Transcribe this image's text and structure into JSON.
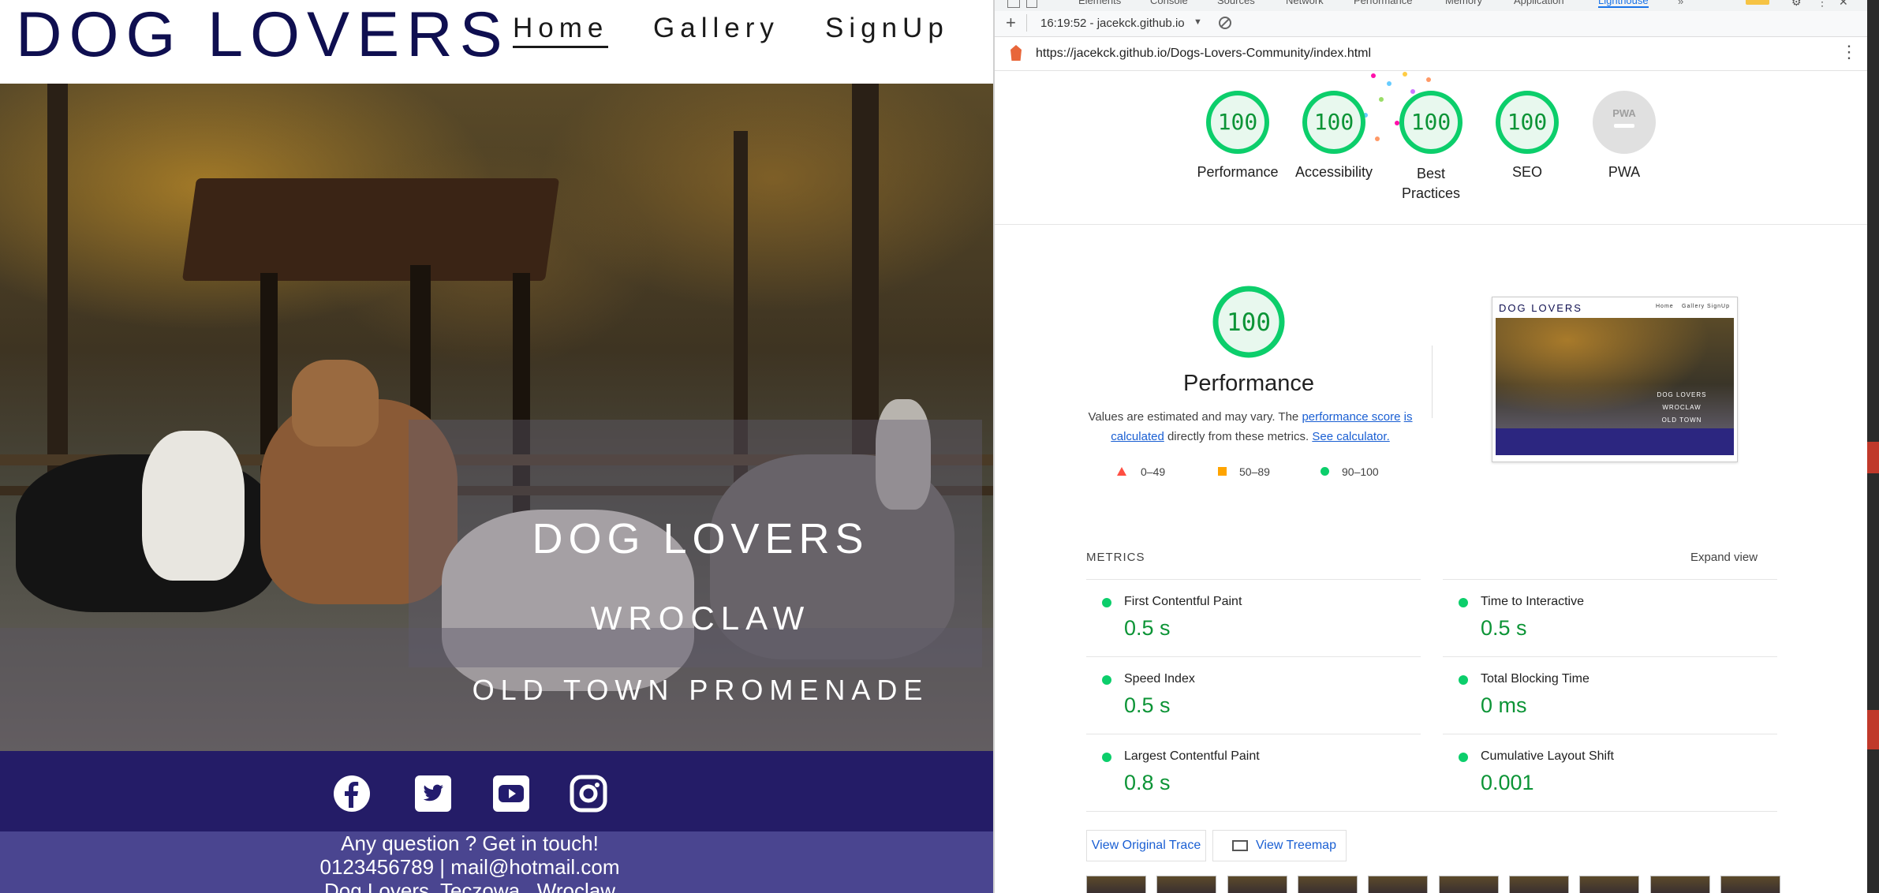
{
  "site": {
    "logo": "DOG LOVERS",
    "nav": [
      {
        "label": "Home",
        "active": true
      },
      {
        "label": "Gallery",
        "active": false
      },
      {
        "label": "SignUp",
        "active": false
      }
    ],
    "hero": {
      "title": "DOG LOVERS",
      "city": "WROCLAW",
      "place": "OLD TOWN PROMENADE"
    },
    "social_icons": [
      "facebook-icon",
      "twitter-icon",
      "youtube-icon",
      "instagram-icon"
    ],
    "footer": {
      "question": "Any question ? Get in touch!",
      "contact": "0123456789 | mail@hotmail.com",
      "address": "Dog Lovers, Teczowa , Wroclaw"
    },
    "colors": {
      "logo": "#0f0f50",
      "social_bar": "#231c6e",
      "footer": "#4a4590"
    }
  },
  "devtools": {
    "tabs": [
      "Elements",
      "Console",
      "Sources",
      "Network",
      "Performance",
      "Memory",
      "Application",
      "Lighthouse"
    ],
    "active_tab": "Lighthouse",
    "report_time": "16:19:52 - jacekck.github.io",
    "url": "https://jacekck.github.io/Dogs-Lovers-Community/index.html",
    "gauges": [
      {
        "score": "100",
        "label": "Performance"
      },
      {
        "score": "100",
        "label": "Accessibility"
      },
      {
        "score": "100",
        "label": "Best",
        "label2": "Practices"
      },
      {
        "score": "100",
        "label": "SEO"
      },
      {
        "score": "PWA",
        "label": "PWA"
      }
    ],
    "performance": {
      "score": "100",
      "title": "Performance",
      "desc_prefix": "Values are estimated and may vary. The ",
      "desc_link1a": "performance score",
      "desc_link1b": "is calculated",
      "desc_middle": " directly from these metrics. ",
      "desc_link2": "See calculator.",
      "legend": [
        "0–49",
        "50–89",
        "90–100"
      ]
    },
    "preview": {
      "logo": "DOG LOVERS",
      "nav": [
        "Home",
        "Gallery",
        "SignUp"
      ],
      "lines": [
        "DOG LOVERS",
        "WROCLAW",
        "OLD TOWN PROMENADE"
      ]
    },
    "metrics": {
      "heading": "METRICS",
      "expand": "Expand view",
      "items": [
        {
          "title": "First Contentful Paint",
          "value": "0.5 s"
        },
        {
          "title": "Time to Interactive",
          "value": "0.5 s"
        },
        {
          "title": "Speed Index",
          "value": "0.5 s"
        },
        {
          "title": "Total Blocking Time",
          "value": "0 ms"
        },
        {
          "title": "Largest Contentful Paint",
          "value": "0.8 s"
        },
        {
          "title": "Cumulative Layout Shift",
          "value": "0.001"
        }
      ]
    },
    "buttons": {
      "trace": "View Original Trace",
      "treemap": "View Treemap"
    },
    "colors": {
      "pass": "#0cce6b",
      "pass_text": "#0c9436",
      "average": "#ffa400",
      "fail": "#ff4e42",
      "link": "#1a5fd3"
    }
  }
}
